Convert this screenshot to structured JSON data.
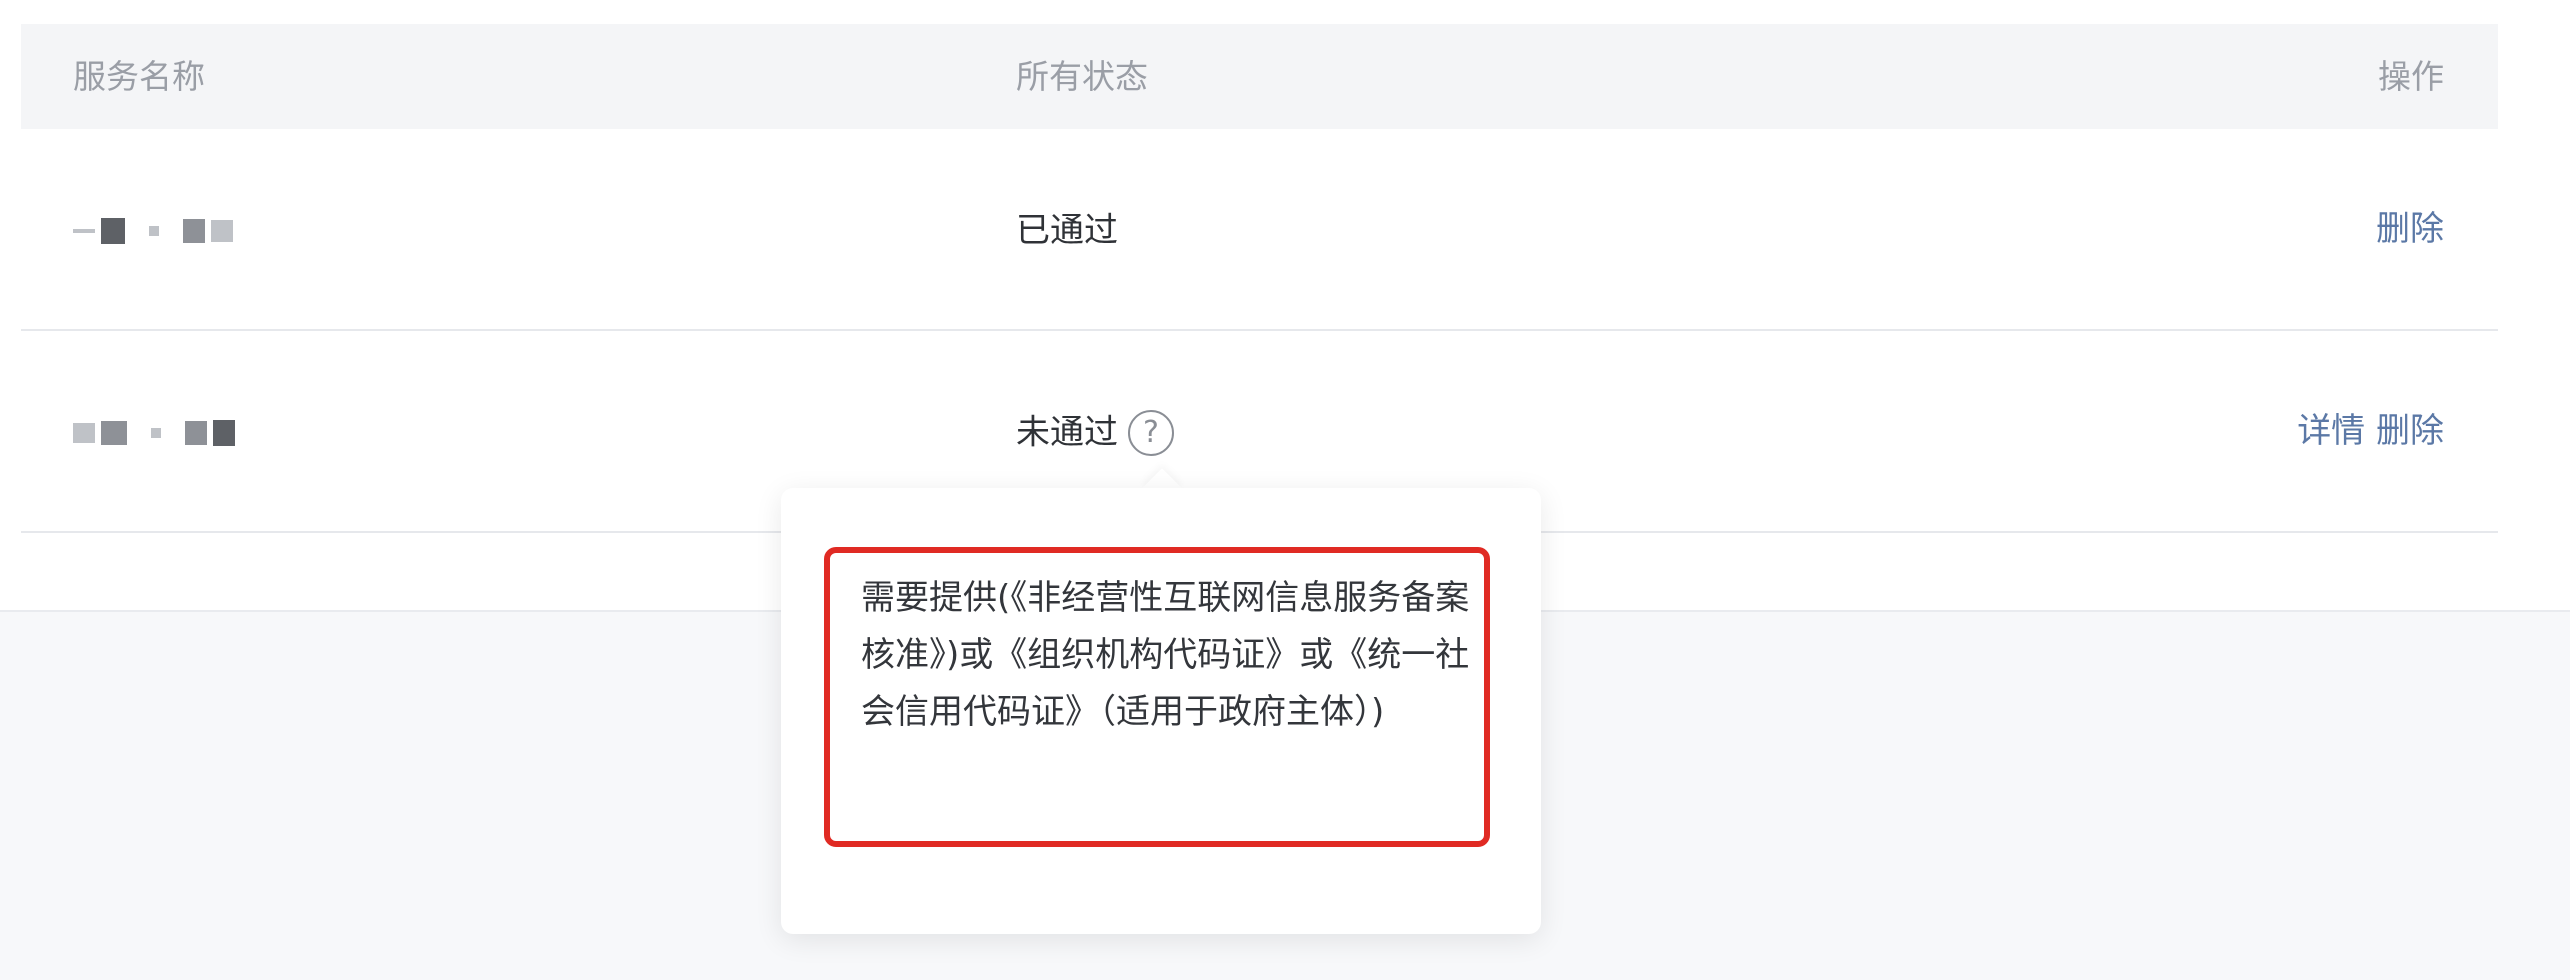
{
  "table": {
    "headers": {
      "service_name": "服务名称",
      "status": "所有状态",
      "action": "操作"
    },
    "rows": [
      {
        "service_name_masked": true,
        "status": "已通过",
        "show_help_icon": false,
        "actions": [
          "删除"
        ]
      },
      {
        "service_name_masked": true,
        "status": "未通过",
        "show_help_icon": true,
        "actions": [
          "详情",
          "删除"
        ]
      }
    ]
  },
  "help_icon": {
    "glyph": "?",
    "icon": "question-circle-icon"
  },
  "tooltip": {
    "text": "需要提供(《非经营性互联网信息服务备案核准》)或《组织机构代码证》或《统一社会信用代码证》（适用于政府主体）)",
    "highlight_color": "#e02a23"
  },
  "colors": {
    "link": "#5b78a6",
    "header_text": "#9a9ea6",
    "body_text": "#2f3237"
  }
}
